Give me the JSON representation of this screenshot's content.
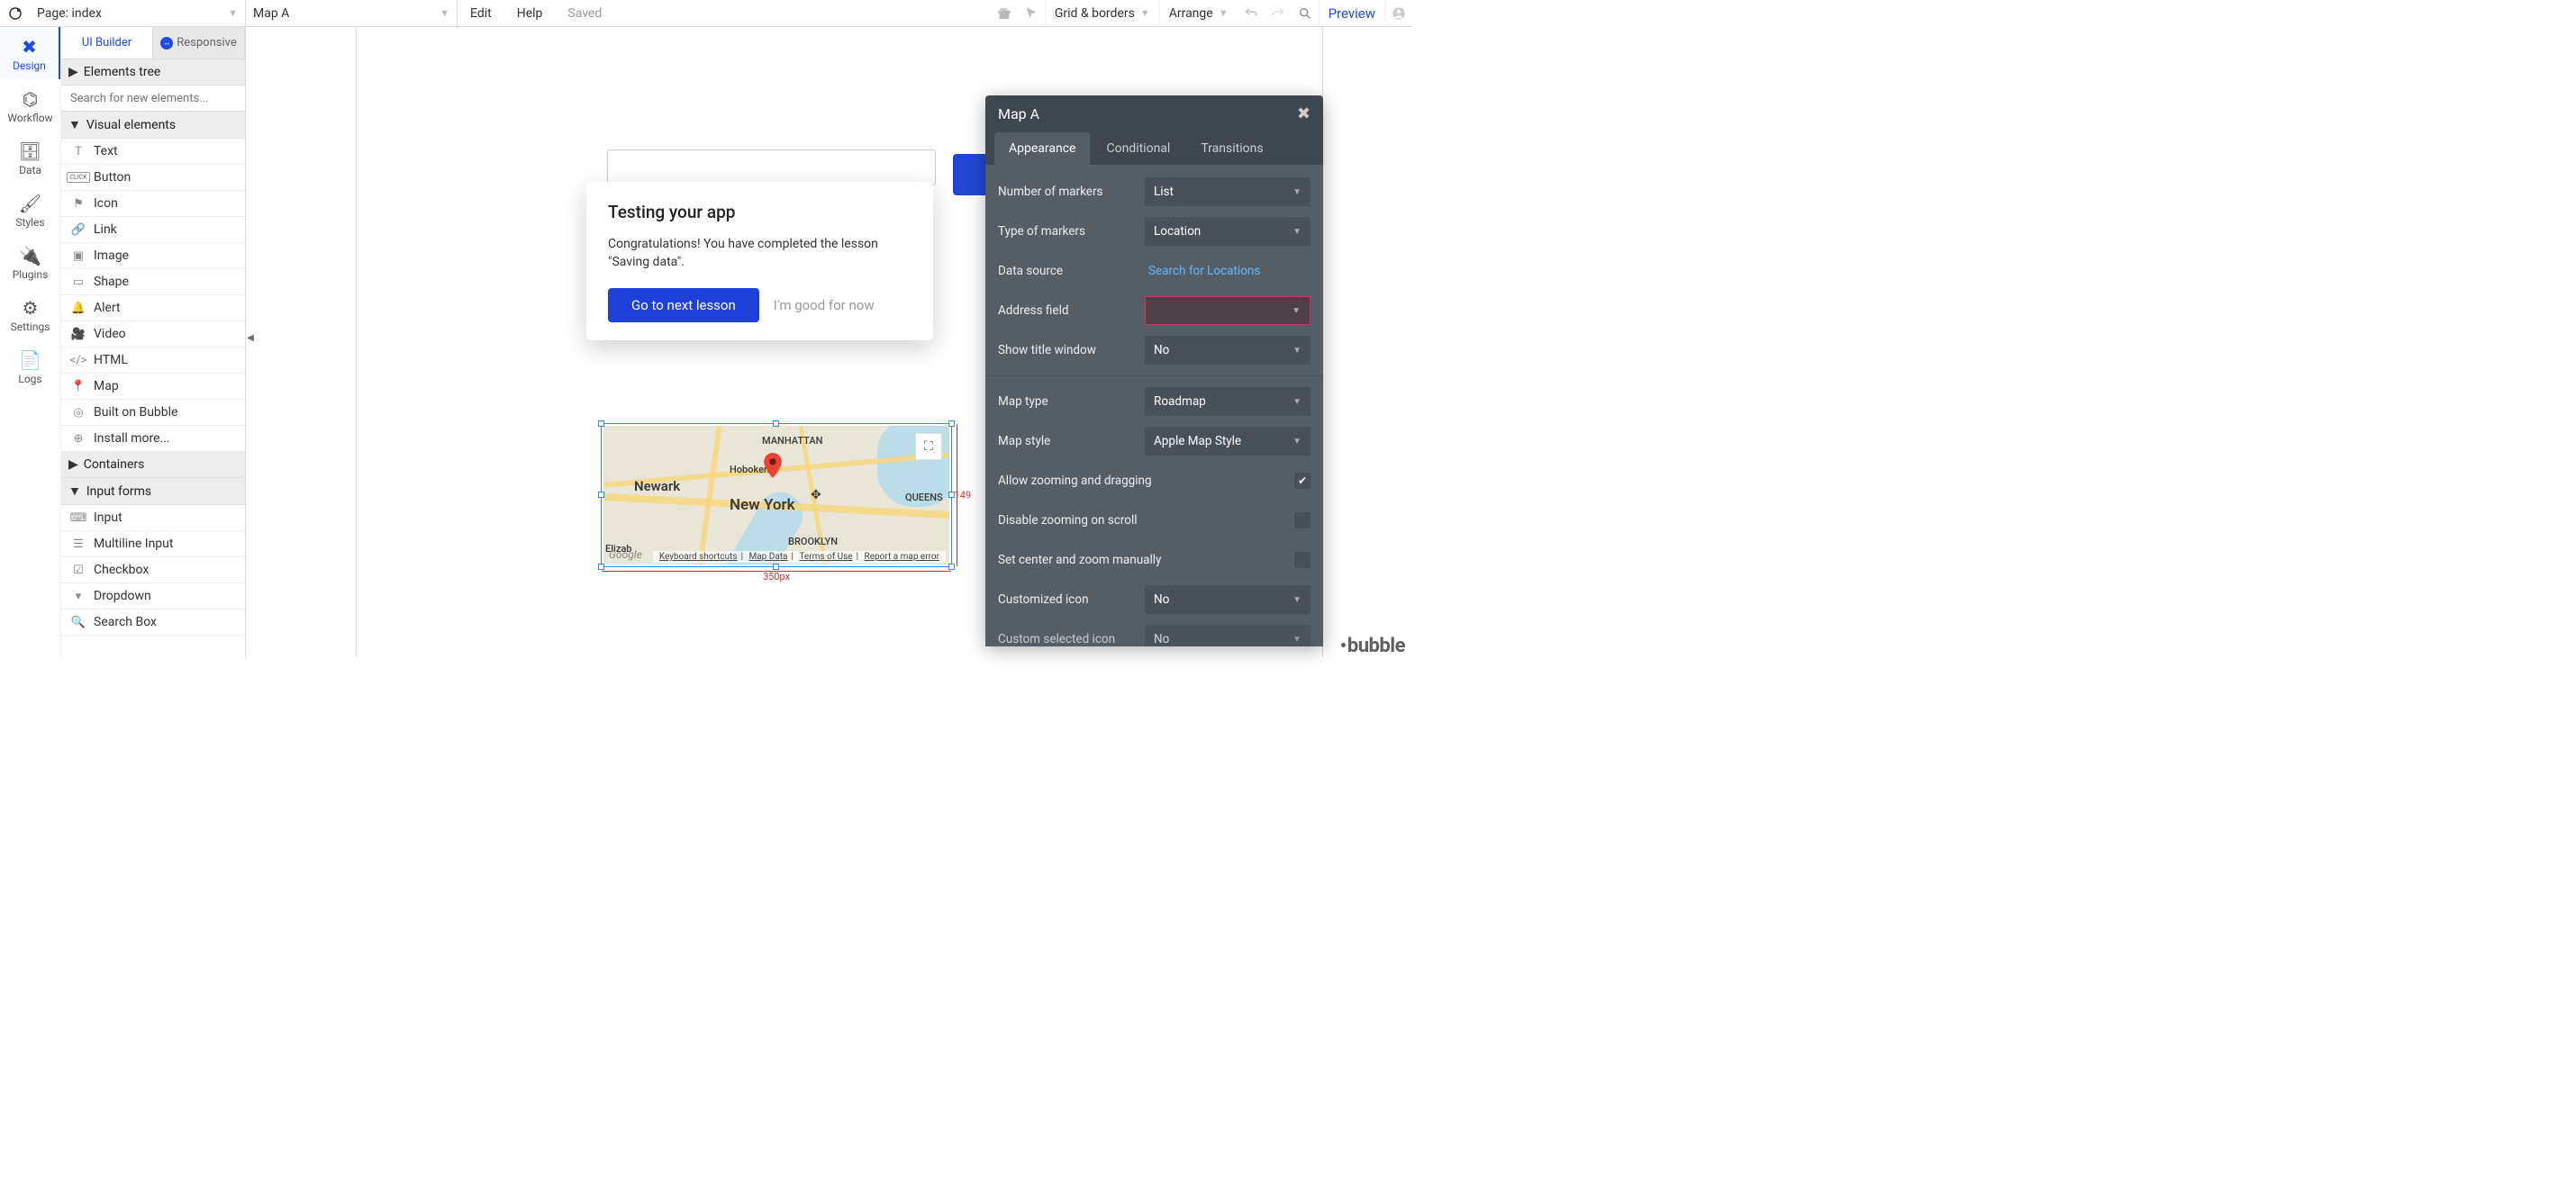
{
  "topbar": {
    "page_dropdown": "Page: index",
    "element_dropdown": "Map A",
    "menu_edit": "Edit",
    "menu_help": "Help",
    "saved": "Saved",
    "grid_borders": "Grid & borders",
    "arrange": "Arrange",
    "preview": "Preview"
  },
  "sidebar": {
    "items": [
      {
        "label": "Design"
      },
      {
        "label": "Workflow"
      },
      {
        "label": "Data"
      },
      {
        "label": "Styles"
      },
      {
        "label": "Plugins"
      },
      {
        "label": "Settings"
      },
      {
        "label": "Logs"
      }
    ]
  },
  "leftpanel": {
    "tab_ui": "UI Builder",
    "tab_responsive": "Responsive",
    "sec_elements_tree": "Elements tree",
    "search_placeholder": "Search for new elements...",
    "sec_visual": "Visual elements",
    "visual_items": [
      "Text",
      "Button",
      "Icon",
      "Link",
      "Image",
      "Shape",
      "Alert",
      "Video",
      "HTML",
      "Map",
      "Built on Bubble",
      "Install more..."
    ],
    "sec_containers": "Containers",
    "sec_input_forms": "Input forms",
    "input_items": [
      "Input",
      "Multiline Input",
      "Checkbox",
      "Dropdown",
      "Search Box"
    ]
  },
  "canvas": {
    "map": {
      "width_label": "350px",
      "height_label": "149",
      "city": "New York",
      "places": [
        "Newark",
        "Hoboken",
        "MANHATTAN",
        "BROOKLYN",
        "QUEENS",
        "Elizab"
      ],
      "google": "Google",
      "bottom_links": [
        "Keyboard shortcuts",
        "Map Data",
        "Terms of Use",
        "Report a map error"
      ]
    }
  },
  "tutorial": {
    "title": "Testing your app",
    "body": "Congratulations! You have completed the lesson \"Saving data\".",
    "btn_next": "Go to next lesson",
    "btn_skip": "I'm good for now"
  },
  "proppanel": {
    "title": "Map A",
    "tabs": [
      "Appearance",
      "Conditional",
      "Transitions"
    ],
    "rows": {
      "num_markers": {
        "label": "Number of markers",
        "value": "List"
      },
      "type_markers": {
        "label": "Type of markers",
        "value": "Location"
      },
      "data_source": {
        "label": "Data source",
        "value": "Search for Locations"
      },
      "address_field": {
        "label": "Address field",
        "value": ""
      },
      "show_title": {
        "label": "Show title window",
        "value": "No"
      },
      "map_type": {
        "label": "Map type",
        "value": "Roadmap"
      },
      "map_style": {
        "label": "Map style",
        "value": "Apple Map Style"
      },
      "allow_zoom": {
        "label": "Allow zooming and dragging",
        "checked": true
      },
      "disable_scroll": {
        "label": "Disable zooming on scroll",
        "checked": false
      },
      "set_center": {
        "label": "Set center and zoom manually",
        "checked": false
      },
      "custom_icon": {
        "label": "Customized icon",
        "value": "No"
      },
      "custom_sel_icon": {
        "label": "Custom selected icon",
        "value": "No"
      }
    }
  },
  "brand": "bubble"
}
